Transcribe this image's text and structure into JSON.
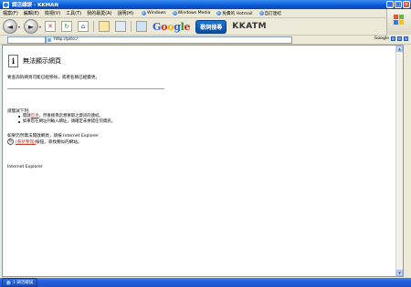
{
  "window": {
    "title": "調活總誤 - KKMAN",
    "min_glyph": "_",
    "max_glyph": "□",
    "close_glyph": "×"
  },
  "menubar": {
    "items": [
      "檔案(F)",
      "編輯(E)",
      "檢視(V)",
      "工具(T)",
      "我的最愛(A)",
      "說明(H)"
    ],
    "links": [
      "Windows",
      "Windows Media",
      "免費的 Hotmail",
      "自訂連結"
    ]
  },
  "toolbar": {
    "back_glyph": "◄",
    "forward_glyph": "►",
    "dropdown_glyph": "▾",
    "stop_glyph": "✕",
    "refresh_glyph": "↻",
    "home_glyph": "⌂",
    "google_logo": [
      "G",
      "o",
      "o",
      "g",
      "l",
      "e"
    ],
    "search_logo": "歌詞搜尋",
    "kkatm_logo": "KKATM"
  },
  "addressbar": {
    "url": "http://pito:/",
    "search_engine": "Google"
  },
  "page": {
    "icon_glyph": "i",
    "title": "無法顯示網頁",
    "description": "要查詢的網頁可能已經移除，或者名稱已經變更。",
    "try_label": "請嘗試下列:",
    "bullet1_pre": "開啟",
    "bullet1_link": "首頁",
    "bullet1_post": "，然後搜尋您想要取之資訊的連結。",
    "bullet2": "如果您在網址列輸入網址，請確定未拼錯任何資訊。",
    "help_text": "如果仍然無法開啟網頁，請按 Internet Explorer",
    "refresh_glyph": "↻",
    "refresh_link": "[重新整理]",
    "refresh_post": "按鈕，尋找類似的網站。",
    "footer": "Internet Explorer"
  },
  "taskbar": {
    "item_label": "1 調活總誤"
  }
}
